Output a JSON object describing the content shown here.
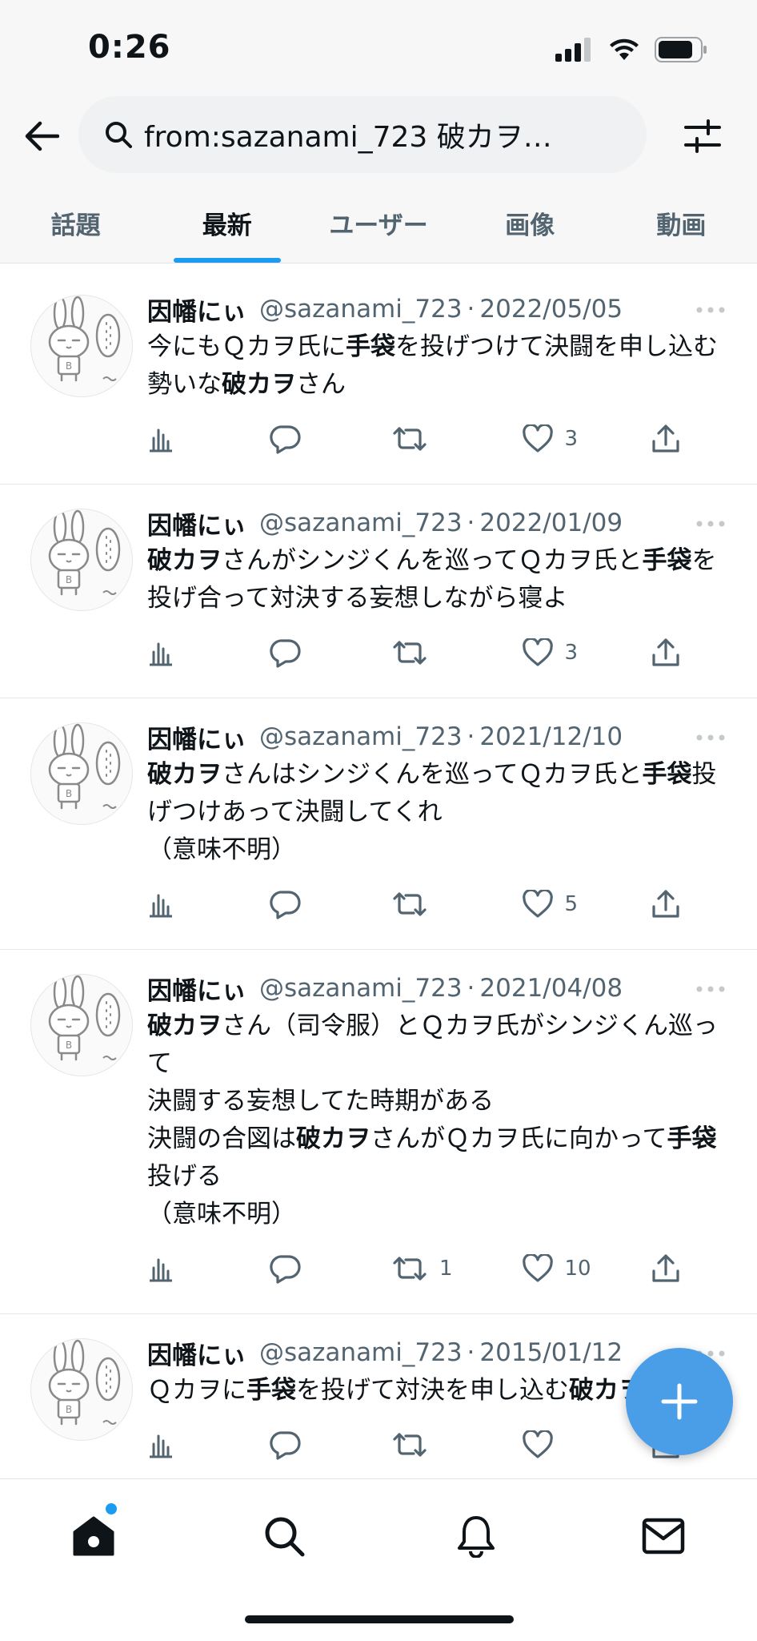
{
  "status_bar": {
    "time": "0:26"
  },
  "header": {
    "search_text": "from:sazanami_723 破カヲ…"
  },
  "tabs": [
    {
      "label": "話題"
    },
    {
      "label": "最新"
    },
    {
      "label": "ユーザー"
    },
    {
      "label": "画像"
    },
    {
      "label": "動画"
    }
  ],
  "active_tab": "最新",
  "accent_color": "#1d9bf0",
  "tweets": [
    {
      "name": "因幡にぃ",
      "handle": "@sazanami_723",
      "date": "2022/05/05",
      "segments": [
        {
          "t": "今にもＱカヲ氏に"
        },
        {
          "t": "手袋",
          "b": true
        },
        {
          "t": "を投げつけて決闘を申し込む勢いな"
        },
        {
          "t": "破カヲ",
          "b": true
        },
        {
          "t": "さん"
        }
      ],
      "reply_count": "",
      "retweet_count": "",
      "like_count": "3"
    },
    {
      "name": "因幡にぃ",
      "handle": "@sazanami_723",
      "date": "2022/01/09",
      "segments": [
        {
          "t": "破カヲ",
          "b": true
        },
        {
          "t": "さんがシンジくんを巡ってＱカヲ氏と"
        },
        {
          "t": "手袋",
          "b": true
        },
        {
          "t": "を投げ合って対決する妄想しながら寝よ"
        }
      ],
      "reply_count": "",
      "retweet_count": "",
      "like_count": "3"
    },
    {
      "name": "因幡にぃ",
      "handle": "@sazanami_723",
      "date": "2021/12/10",
      "segments": [
        {
          "t": "破カヲ",
          "b": true
        },
        {
          "t": "さんはシンジくんを巡ってＱカヲ氏と"
        },
        {
          "t": "手袋",
          "b": true
        },
        {
          "t": "投げつけあって決闘してくれ"
        },
        {
          "br": true
        },
        {
          "t": "（意味不明）"
        }
      ],
      "reply_count": "",
      "retweet_count": "",
      "like_count": "5"
    },
    {
      "name": "因幡にぃ",
      "handle": "@sazanami_723",
      "date": "2021/04/08",
      "segments": [
        {
          "t": "破カヲ",
          "b": true
        },
        {
          "t": "さん（司令服）とＱカヲ氏がシンジくん巡って"
        },
        {
          "br": true
        },
        {
          "t": "決闘する妄想してた時期がある"
        },
        {
          "br": true
        },
        {
          "t": "決闘の合図は"
        },
        {
          "t": "破カヲ",
          "b": true
        },
        {
          "t": "さんがＱカヲ氏に向かって"
        },
        {
          "t": "手袋",
          "b": true
        },
        {
          "t": "投げる"
        },
        {
          "br": true
        },
        {
          "t": "（意味不明）"
        }
      ],
      "reply_count": "",
      "retweet_count": "1",
      "like_count": "10"
    },
    {
      "name": "因幡にぃ",
      "handle": "@sazanami_723",
      "date": "2015/01/12",
      "segments": [
        {
          "t": "Ｑカヲに"
        },
        {
          "t": "手袋",
          "b": true
        },
        {
          "t": "を投げて対決を申し込む"
        },
        {
          "t": "破カヲ",
          "b": true
        },
        {
          "t": "……"
        }
      ],
      "reply_count": "",
      "retweet_count": "",
      "like_count": ""
    }
  ],
  "icons": {
    "back": "arrow-left-icon",
    "search": "search-icon",
    "filter": "sliders-icon",
    "views": "bar-chart-icon",
    "reply": "reply-icon",
    "retweet": "retweet-icon",
    "like": "heart-icon",
    "share": "share-icon",
    "compose": "plus-icon",
    "home": "home-icon",
    "explore": "search-icon",
    "notifications": "bell-icon",
    "messages": "mail-icon"
  }
}
